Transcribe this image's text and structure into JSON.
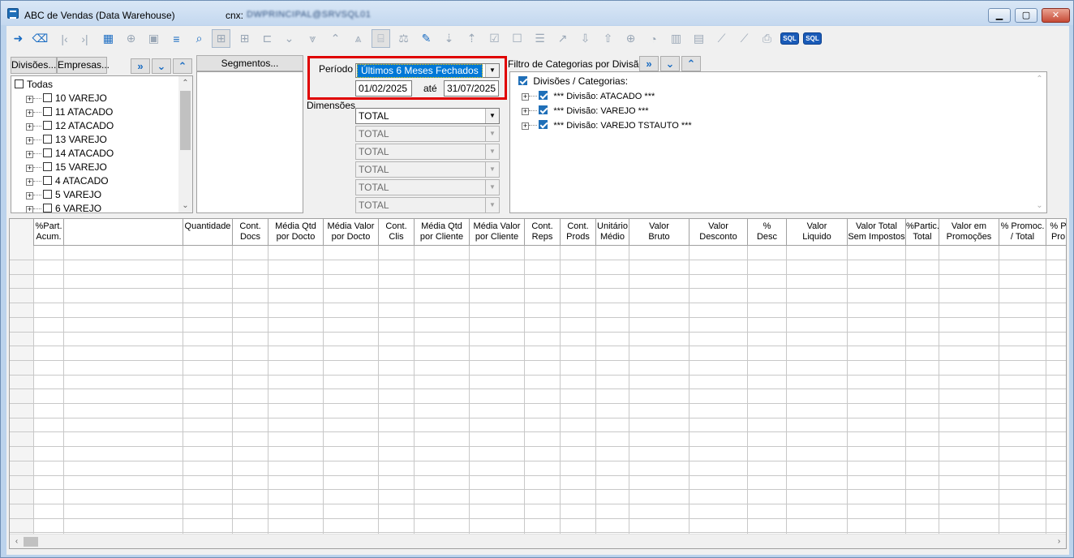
{
  "window": {
    "title": "ABC de Vendas (Data Warehouse)",
    "cnx_label": "cnx:",
    "cnx_value": "DWPRINCIPAL@SRVSQL01",
    "controls": {
      "min": "▁",
      "max": "▢",
      "close": "✕"
    }
  },
  "toolbar": {
    "icons": [
      "exit-icon",
      "eraser-icon",
      "first-icon",
      "last-icon",
      "table-icon",
      "add-circle-icon",
      "save-icon",
      "filter-icon",
      "search-icon",
      "grid-icon",
      "grid-alt-icon",
      "hierarchy-icon",
      "chevron-down-icon",
      "double-chevron-down-icon",
      "chevron-up-icon",
      "double-chevron-up-icon",
      "abacus-icon",
      "balance-icon",
      "pencil-icon",
      "sort-desc-icon",
      "sort-asc-icon",
      "checklist-icon",
      "checklist-alt-icon",
      "list-icon",
      "export-icon",
      "move-down-icon",
      "move-up-icon",
      "zoom-in-icon",
      "pie-chart-icon",
      "bar-chart-icon",
      "bar-chart-horizontal-icon",
      "line-chart-icon",
      "line-chart-alt-icon",
      "printer-icon",
      "sql-icon",
      "sql-alt-icon"
    ],
    "sql_label": "SQL"
  },
  "filters": {
    "divisoes_btn": "Divisões...",
    "empresas_btn": "Empresas...",
    "expand_all": "»",
    "expand_down": "⌄",
    "expand_up": "⌃",
    "segmentos_btn": "Segmentos...",
    "tree": {
      "root": "Todas",
      "items": [
        "10 VAREJO",
        "11 ATACADO",
        "12 ATACADO",
        "13 VAREJO",
        "14 ATACADO",
        "15 VAREJO",
        "4 ATACADO",
        "5 VAREJO",
        "6 VAREJO"
      ]
    }
  },
  "periodo": {
    "label": "Período",
    "selected": "Últimos  6 Meses Fechados",
    "date_from": "01/02/2025",
    "ate_label": "até",
    "date_to": "31/07/2025"
  },
  "dimensoes": {
    "label": "Dimensões",
    "values": [
      "TOTAL",
      "TOTAL",
      "TOTAL",
      "TOTAL",
      "TOTAL",
      "TOTAL"
    ]
  },
  "categorias": {
    "label": "Filtro de Categorias por Divisão",
    "root": "Divisões / Categorias:",
    "items": [
      "*** Divisão: ATACADO ***",
      "*** Divisão: VAREJO ***",
      "*** Divisão: VAREJO TSTAUTO ***"
    ]
  },
  "grid": {
    "columns": [
      "",
      "%Part.\nAcum.",
      "",
      "Quantidade",
      "Cont.\nDocs",
      "Média Qtd\npor Docto",
      "Média Valor\npor Docto",
      "Cont.\nClis",
      "Média Qtd\npor Cliente",
      "Média Valor\npor Cliente",
      "Cont.\nReps",
      "Cont.\nProds",
      "Unitário\nMédio",
      "Valor\nBruto",
      "Valor\nDesconto",
      "%\nDesc",
      "Valor\nLiquido",
      "Valor Total\nSem Impostos",
      "%Partic.\nTotal",
      "Valor em\nPromoções",
      "% Promoc.\n/ Total",
      "% P\nPro"
    ]
  }
}
